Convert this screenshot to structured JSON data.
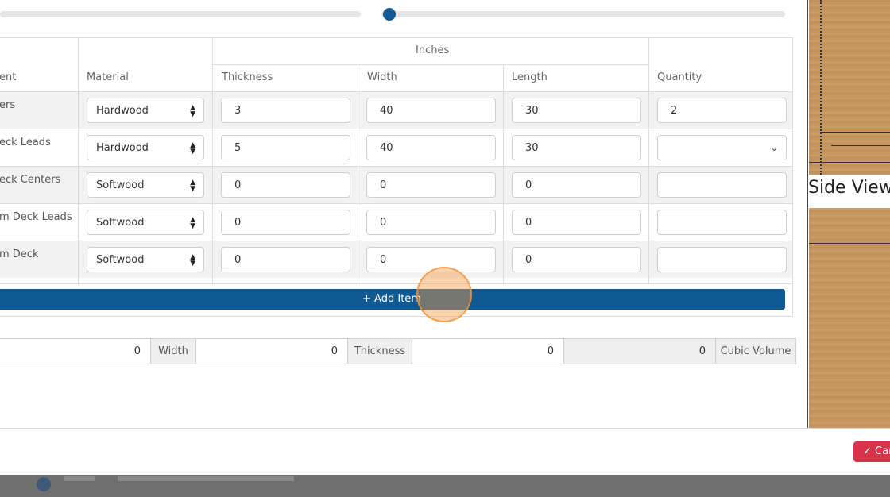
{
  "table": {
    "group_header": "Inches",
    "headers": {
      "component": "ent",
      "material": "Material",
      "thickness": "Thickness",
      "width": "Width",
      "length": "Length",
      "quantity": "Quantity"
    },
    "rows": [
      {
        "label": "ers",
        "material": "Hardwood",
        "thickness": "3",
        "width": "40",
        "length": "30",
        "quantity": "2"
      },
      {
        "label": "eck Leads",
        "material": "Hardwood",
        "thickness": "5",
        "width": "40",
        "length": "30",
        "quantity": ""
      },
      {
        "label": "eck Centers",
        "material": "Softwood",
        "thickness": "0",
        "width": "0",
        "length": "0",
        "quantity": ""
      },
      {
        "label": "m Deck Leads",
        "material": "Softwood",
        "thickness": "0",
        "width": "0",
        "length": "0",
        "quantity": ""
      },
      {
        "label": "m Deck",
        "material": "Softwood",
        "thickness": "0",
        "width": "0",
        "length": "0",
        "quantity": ""
      }
    ]
  },
  "add_item_label": "+ Add Item",
  "totals": {
    "length_value": "0",
    "width_label": "Width",
    "width_value": "0",
    "thickness_label": "Thickness",
    "thickness_value": "0",
    "cubic_value": "0",
    "cubic_label": "Cubic Volume"
  },
  "side_view_label": "Side View",
  "confirm_label": "✓ Car",
  "colors": {
    "primary": "#0f5a92",
    "danger": "#d9334a",
    "wood": "#c89a63"
  }
}
